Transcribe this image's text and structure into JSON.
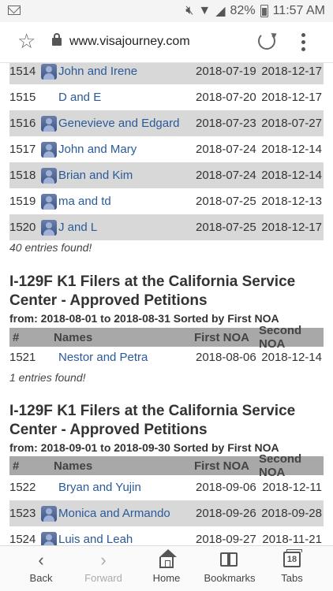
{
  "status_bar": {
    "battery": "82%",
    "time": "11:57 AM"
  },
  "url_bar": {
    "url": "www.visajourney.com"
  },
  "first_table": {
    "rows": [
      {
        "num": "1514",
        "name": "John and Irene",
        "first": "2018-07-19",
        "second": "2018-12-17",
        "avatar": true
      },
      {
        "num": "1515",
        "name": "D and E",
        "first": "2018-07-20",
        "second": "2018-12-17",
        "avatar": false
      },
      {
        "num": "1516",
        "name": "Genevieve and Edgard",
        "first": "2018-07-23",
        "second": "2018-07-27",
        "avatar": true
      },
      {
        "num": "1517",
        "name": "John and Mary",
        "first": "2018-07-24",
        "second": "2018-12-14",
        "avatar": true
      },
      {
        "num": "1518",
        "name": "Brian and Kim",
        "first": "2018-07-24",
        "second": "2018-12-14",
        "avatar": true
      },
      {
        "num": "1519",
        "name": "ma and td",
        "first": "2018-07-25",
        "second": "2018-12-13",
        "avatar": true
      },
      {
        "num": "1520",
        "name": "J and L",
        "first": "2018-07-25",
        "second": "2018-12-17",
        "avatar": true
      }
    ],
    "found": "40 entries found!"
  },
  "section2": {
    "title_line1": "I-129F K1 Filers at the California Service",
    "title_line2": "Center - Approved Petitions",
    "range": "from: 2018-08-01 to 2018-08-31 Sorted by First NOA",
    "headers": {
      "num": "#",
      "names": "Names",
      "first": "First NOA",
      "second": "Second NOA"
    },
    "rows": [
      {
        "num": "1521",
        "name": "Nestor and Petra",
        "first": "2018-08-06",
        "second": "2018-12-14",
        "avatar": false
      }
    ],
    "found": "1 entries found!"
  },
  "section3": {
    "title_line1": "I-129F K1 Filers at the California Service",
    "title_line2": "Center - Approved Petitions",
    "range": "from: 2018-09-01 to 2018-09-30 Sorted by First NOA",
    "headers": {
      "num": "#",
      "names": "Names",
      "first": "First NOA",
      "second": "Second NOA"
    },
    "rows": [
      {
        "num": "1522",
        "name": "Bryan and Yujin",
        "first": "2018-09-06",
        "second": "2018-12-11",
        "avatar": false
      },
      {
        "num": "1523",
        "name": "Monica and Armando",
        "first": "2018-09-26",
        "second": "2018-09-28",
        "avatar": true
      },
      {
        "num": "1524",
        "name": "Luis and Leah",
        "first": "2018-09-27",
        "second": "2018-11-21",
        "avatar": true
      }
    ]
  },
  "bottom_nav": {
    "back": "Back",
    "forward": "Forward",
    "home": "Home",
    "bookmarks": "Bookmarks",
    "tabs": "Tabs",
    "tabs_count": "18"
  }
}
